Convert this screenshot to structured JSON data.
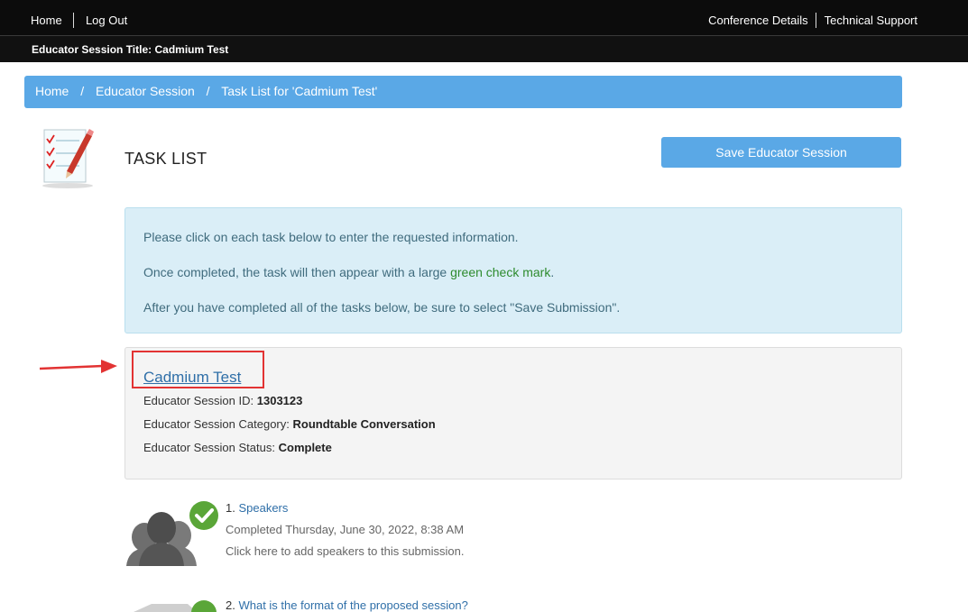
{
  "topbar": {
    "home": "Home",
    "logout": "Log Out",
    "conference_details": "Conference Details",
    "technical_support": "Technical Support"
  },
  "titlebar": {
    "label": "Educator Session Title:",
    "value": "Cadmium Test"
  },
  "breadcrumb": {
    "items": [
      "Home",
      "Educator Session",
      "Task List for 'Cadmium Test'"
    ],
    "separator": "/"
  },
  "page": {
    "title": "TASK LIST",
    "save_button": "Save Educator Session"
  },
  "info": {
    "line1": "Please click on each task below to enter the requested information.",
    "line2_before": "Once completed, the task will then appear with a large ",
    "line2_green": "green check mark",
    "line2_after": ".",
    "line3": "After you have completed all of the tasks below, be sure to select \"Save Submission\"."
  },
  "session": {
    "title": "Cadmium Test",
    "id_label": "Educator Session ID:",
    "id_value": "1303123",
    "category_label": "Educator Session Category:",
    "category_value": "Roundtable Conversation",
    "status_label": "Educator Session Status:",
    "status_value": "Complete"
  },
  "tasks": [
    {
      "number": "1.",
      "title": "Speakers",
      "completed": "Completed Thursday, June 30, 2022, 8:38 AM",
      "description": "Click here to add speakers to this submission."
    },
    {
      "number": "2.",
      "title": "What is the format of the proposed session?"
    }
  ],
  "colors": {
    "accent": "#5aa8e6",
    "check_green": "#5aa638",
    "highlight_red": "#e23333"
  }
}
